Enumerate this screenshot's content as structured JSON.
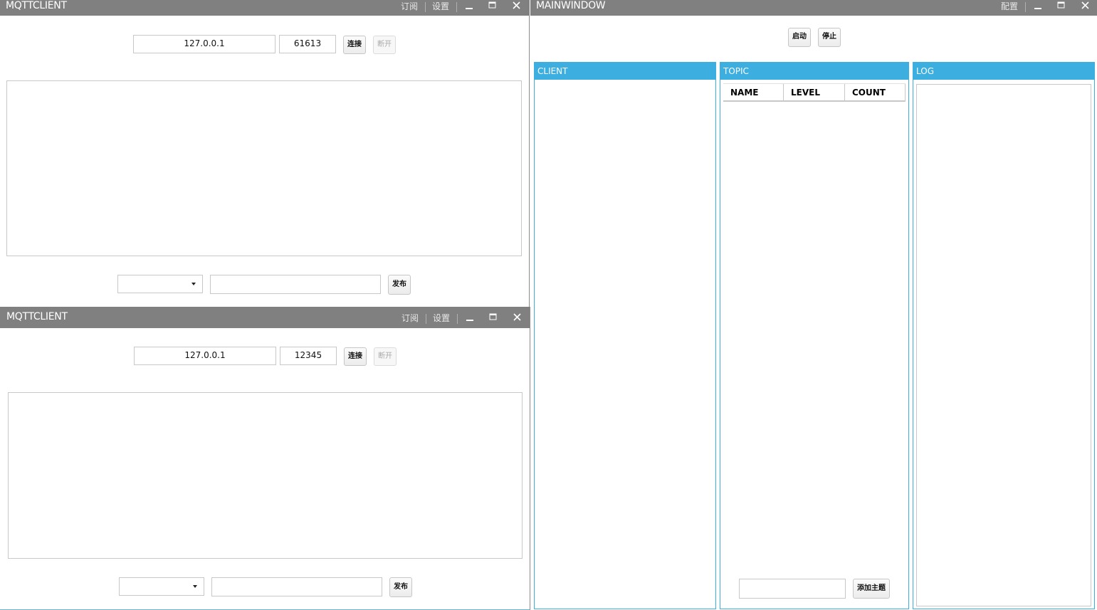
{
  "clients": [
    {
      "title": "MQTTCLIENT",
      "titlebar": {
        "subscribe": "订阅",
        "settings": "设置"
      },
      "host": "127.0.0.1",
      "port": "61613",
      "connect": "连接",
      "disconnect": "断开",
      "topic_select": "",
      "message": "",
      "publish": "发布"
    },
    {
      "title": "MQTTCLIENT",
      "titlebar": {
        "subscribe": "订阅",
        "settings": "设置"
      },
      "host": "127.0.0.1",
      "port": "12345",
      "connect": "连接",
      "disconnect": "断开",
      "topic_select": "",
      "message": "",
      "publish": "发布"
    }
  ],
  "main": {
    "title": "MAINWINDOW",
    "config": "配置",
    "start": "启动",
    "stop": "停止",
    "panels": {
      "client": "CLIENT",
      "topic": "TOPIC",
      "log": "LOG"
    },
    "topic_columns": [
      "NAME",
      "LEVEL",
      "COUNT"
    ],
    "add_topic_input": "",
    "add_topic": "添加主题"
  },
  "colors": {
    "titlebar": "#808080",
    "accent": "#3daee0"
  },
  "icons": [
    "minimize-icon",
    "maximize-icon",
    "close-icon",
    "dropdown-arrow-icon"
  ]
}
